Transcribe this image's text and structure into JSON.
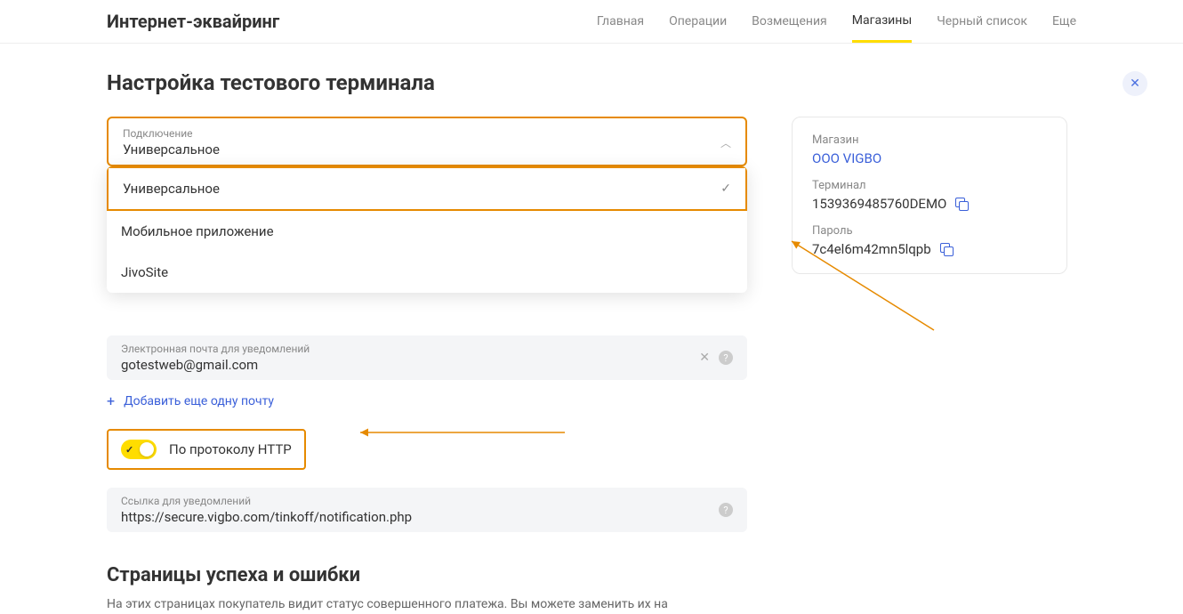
{
  "header": {
    "brand": "Интернет-эквайринг",
    "nav": [
      "Главная",
      "Операции",
      "Возмещения",
      "Магазины",
      "Черный список",
      "Еще"
    ],
    "active_index": 3
  },
  "page": {
    "title": "Настройка тестового терминала"
  },
  "connection_select": {
    "label": "Подключение",
    "value": "Универсальное",
    "options": [
      "Универсальное",
      "Мобильное приложение",
      "JivoSite"
    ],
    "selected_index": 0
  },
  "email_field": {
    "label": "Электронная почта для уведомлений",
    "value": "gotestweb@gmail.com"
  },
  "add_email": {
    "label": "Добавить еще одну почту"
  },
  "http_toggle": {
    "label": "По протоколу HTTP",
    "on": true
  },
  "url_field": {
    "label": "Ссылка для уведомлений",
    "value": "https://secure.vigbo.com/tinkoff/notification.php"
  },
  "section2": {
    "title": "Страницы успеха и ошибки",
    "desc": "На этих страницах покупатель видит статус совершенного платежа. Вы можете заменить их на"
  },
  "side": {
    "shop_label": "Магазин",
    "shop_value": "ООО VIGBO",
    "terminal_label": "Терминал",
    "terminal_value": "1539369485760DEMO",
    "password_label": "Пароль",
    "password_value": "7c4el6m42mn5lqpb"
  }
}
